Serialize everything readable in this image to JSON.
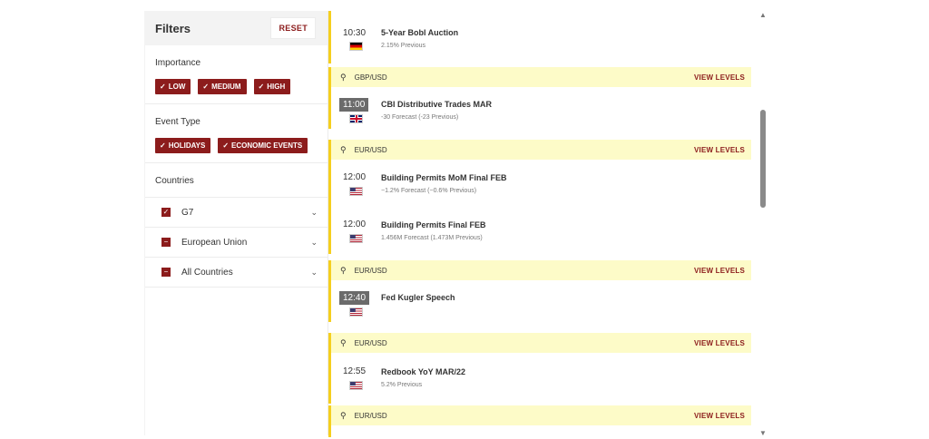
{
  "filters": {
    "title": "Filters",
    "reset_label": "RESET",
    "importance": {
      "label": "Importance",
      "chips": [
        "LOW",
        "MEDIUM",
        "HIGH"
      ]
    },
    "event_type": {
      "label": "Event Type",
      "chips": [
        "HOLIDAYS",
        "ECONOMIC EVENTS"
      ]
    },
    "countries": {
      "label": "Countries",
      "items": [
        {
          "name": "G7",
          "state": "checked"
        },
        {
          "name": "European Union",
          "state": "partial"
        },
        {
          "name": "All Countries",
          "state": "partial"
        }
      ]
    }
  },
  "events": {
    "view_levels_label": "VIEW LEVELS",
    "groups": [
      {
        "pair": "",
        "items": [
          {
            "time": "10:30",
            "title": "5-Year Bobl Auction",
            "detail": "2.15% Previous",
            "flag": "de-flag"
          }
        ]
      },
      {
        "pair": "GBP/USD",
        "items": [
          {
            "time": "11:00",
            "title": "CBI Distributive Trades MAR",
            "detail": "-30 Forecast (-23 Previous)",
            "flag": "gb-flag",
            "highlight": true
          }
        ]
      },
      {
        "pair": "EUR/USD",
        "items": [
          {
            "time": "12:00",
            "title": "Building Permits MoM Final FEB",
            "detail": "−1.2% Forecast (−0.6% Previous)",
            "flag": "us-flag"
          },
          {
            "time": "12:00",
            "title": "Building Permits Final FEB",
            "detail": "1.456M Forecast (1.473M Previous)",
            "flag": "us-flag"
          }
        ]
      },
      {
        "pair": "EUR/USD",
        "items": [
          {
            "time": "12:40",
            "title": "Fed Kugler Speech",
            "detail": "",
            "flag": "us-flag",
            "highlight": true
          }
        ]
      },
      {
        "pair": "EUR/USD",
        "items": [
          {
            "time": "12:55",
            "title": "Redbook YoY MAR/22",
            "detail": "5.2% Previous",
            "flag": "us-flag"
          }
        ]
      },
      {
        "pair": "EUR/USD",
        "items": []
      }
    ]
  },
  "scrollbar": {
    "up_icon": "chevron-up-icon",
    "down_icon": "chevron-down-icon"
  },
  "colors": {
    "accent": "#8c1c1c",
    "highlight_bar": "#f5cf1f",
    "pair_bg": "#fdfbc8"
  }
}
